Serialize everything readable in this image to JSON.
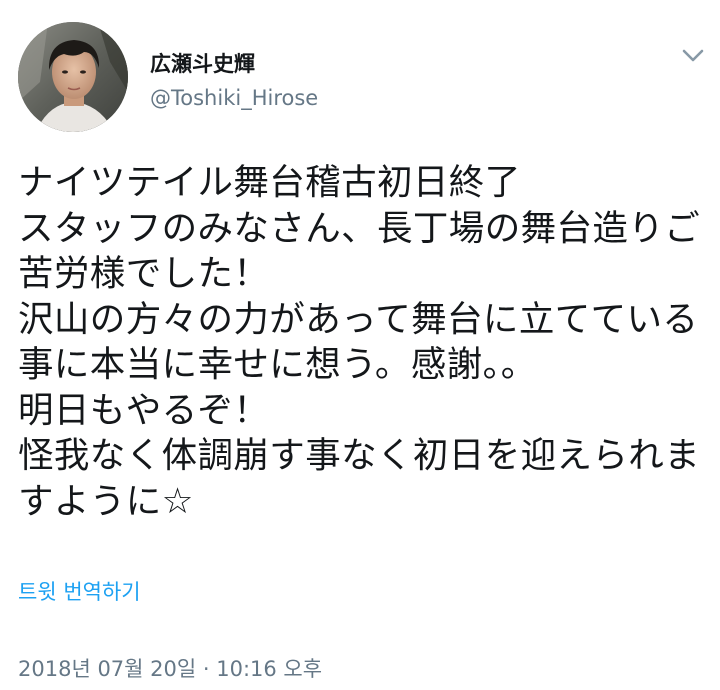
{
  "author": {
    "display_name": "広瀬斗史輝",
    "handle": "@Toshiki_Hirose"
  },
  "tweet": {
    "lines": [
      "ナイツテイル舞台稽古初日終了",
      "スタッフのみなさん、長丁場の舞台造りご",
      "苦労様でした！",
      "沢山の方々の力があって舞台に立てている",
      "事に本当に幸せに想う。感謝。。",
      "明日もやるぞ！",
      "怪我なく体調崩す事なく初日を迎えられま",
      "すように☆"
    ]
  },
  "actions": {
    "translate_label": "트윗 번역하기"
  },
  "meta": {
    "timestamp": "2018년 07월 20일 · 10:16 오후"
  },
  "icons": {
    "menu": "chevron-down-icon"
  },
  "colors": {
    "text": "#14171a",
    "secondary": "#657786",
    "link": "#1da1f2",
    "caret": "#8899a6",
    "background": "#ffffff"
  }
}
